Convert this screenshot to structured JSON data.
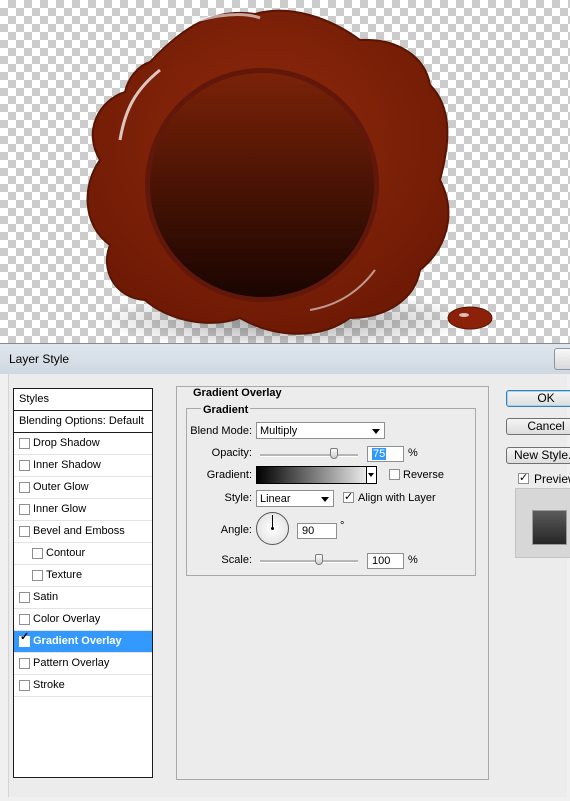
{
  "dialog": {
    "title": "Layer Style"
  },
  "styles_panel": {
    "header": "Styles",
    "blending_options": "Blending Options: Default",
    "items": [
      {
        "label": "Drop Shadow",
        "checked": false
      },
      {
        "label": "Inner Shadow",
        "checked": false
      },
      {
        "label": "Outer Glow",
        "checked": false
      },
      {
        "label": "Inner Glow",
        "checked": false
      },
      {
        "label": "Bevel and Emboss",
        "checked": false
      },
      {
        "label": "Contour",
        "checked": false,
        "sub": true
      },
      {
        "label": "Texture",
        "checked": false,
        "sub": true
      },
      {
        "label": "Satin",
        "checked": false
      },
      {
        "label": "Color Overlay",
        "checked": false
      },
      {
        "label": "Gradient Overlay",
        "checked": true,
        "selected": true
      },
      {
        "label": "Pattern Overlay",
        "checked": false
      },
      {
        "label": "Stroke",
        "checked": false
      }
    ]
  },
  "gradient_overlay": {
    "section_title": "Gradient Overlay",
    "group_title": "Gradient",
    "blend_mode_label": "Blend Mode:",
    "blend_mode_value": "Multiply",
    "opacity_label": "Opacity:",
    "opacity_value": "75",
    "opacity_slider_fraction": 0.75,
    "percent": "%",
    "gradient_label": "Gradient:",
    "reverse_label": "Reverse",
    "reverse_checked": false,
    "style_label": "Style:",
    "style_value": "Linear",
    "align_label": "Align with Layer",
    "align_checked": true,
    "angle_label": "Angle:",
    "angle_value": "90",
    "degree": "°",
    "scale_label": "Scale:",
    "scale_value": "100",
    "scale_slider_fraction": 0.6
  },
  "buttons": {
    "ok": "OK",
    "cancel": "Cancel",
    "new_style": "New Style...",
    "preview_label": "Preview",
    "preview_checked": true
  },
  "colors": {
    "wax_red": "#8a2108",
    "wax_dark": "#1e0602",
    "selection_blue": "#3399ff"
  }
}
